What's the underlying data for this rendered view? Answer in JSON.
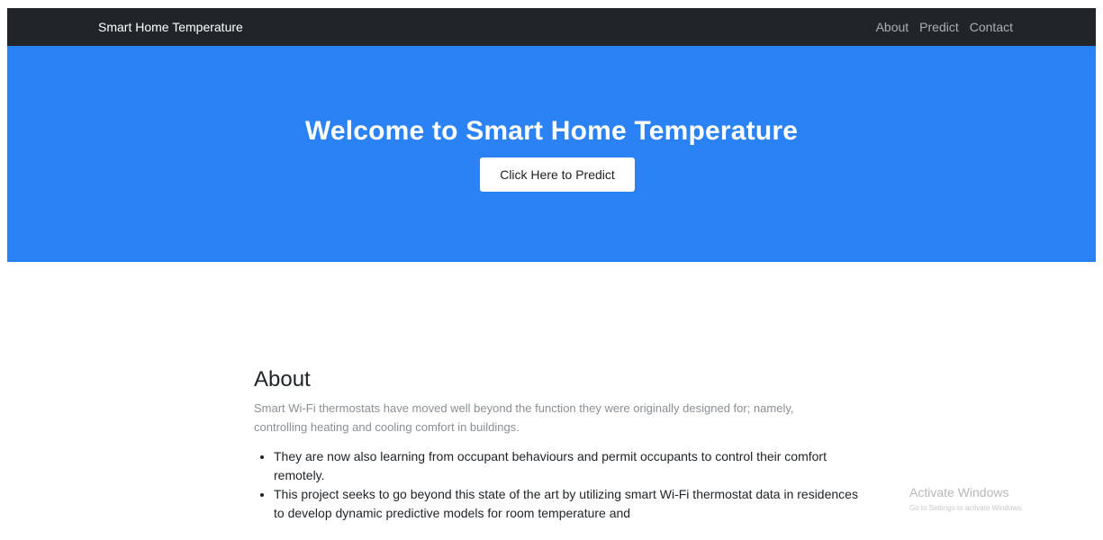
{
  "navbar": {
    "brand": "Smart Home Temperature",
    "links": [
      {
        "label": "About"
      },
      {
        "label": "Predict"
      },
      {
        "label": "Contact"
      }
    ],
    "background": "#212529"
  },
  "hero": {
    "title": "Welcome to Smart Home Temperature",
    "button_label": "Click Here to Predict",
    "background": "#2b82f5"
  },
  "about": {
    "title": "About",
    "lead": "Smart Wi-Fi thermostats have moved well beyond the function they were originally designed for; namely, controlling heating and cooling comfort in buildings.",
    "items": [
      "They are now also learning from occupant behaviours and permit occupants to control their comfort remotely.",
      "This project seeks to go beyond this state of the art by utilizing smart Wi-Fi thermostat data in residences to develop dynamic predictive models for room temperature and"
    ]
  },
  "watermark": {
    "title": "Activate Windows",
    "subtitle": "Go to Settings to activate Windows."
  }
}
